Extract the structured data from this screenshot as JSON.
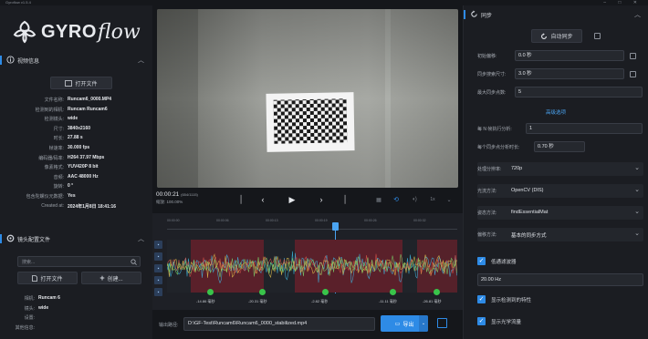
{
  "window": {
    "title": "Gyroflow v1.5.4"
  },
  "logo": {
    "word": "GYRO",
    "script": "flow"
  },
  "video_info": {
    "section_title": "视频信息",
    "open_file_label": "打开文件",
    "rows": [
      {
        "k": "文件名称:",
        "v": "Runcam6_0000.MP4"
      },
      {
        "k": "检测到的相机:",
        "v": "Runcam Runcam6"
      },
      {
        "k": "检测镜头:",
        "v": "wide"
      },
      {
        "k": "尺寸:",
        "v": "3840x2160"
      },
      {
        "k": "时长:",
        "v": "27.88 s"
      },
      {
        "k": "帧速率:",
        "v": "30.000 fps"
      },
      {
        "k": "编码器/码率:",
        "v": "H264 37.97 Mbps"
      },
      {
        "k": "像素格式:",
        "v": "YUV420P 8 bit"
      },
      {
        "k": "音频:",
        "v": "AAC 48000 Hz"
      },
      {
        "k": "旋转:",
        "v": "0 °"
      },
      {
        "k": "包含陀螺仪元数据:",
        "v": "Yes"
      },
      {
        "k": "Created at:",
        "v": "2024年1月8日 18:41:16"
      }
    ]
  },
  "lens_profile": {
    "section_title": "镜头配置文件",
    "search_placeholder": "搜索...",
    "open_file_label": "打开文件",
    "create_label": "创建...",
    "rows": [
      {
        "k": "相机:",
        "v": "Runcam 6"
      },
      {
        "k": "镜头:",
        "v": "wide"
      },
      {
        "k": "设置:",
        "v": ""
      },
      {
        "k": "其他信息:",
        "v": ""
      }
    ]
  },
  "transport": {
    "time": "00:00:21",
    "frame": "(654/1115)",
    "zoom": "缩放: 100.00%",
    "speed": "1x"
  },
  "timeline": {
    "ruler": [
      "00:00:00",
      "00:00:06",
      "00:00:13",
      "00:00:19",
      "00:00:26",
      "00:00:32"
    ],
    "keyframes": [
      "-14.86 毫秒",
      "-20.31 毫秒",
      "-2.82 毫秒",
      "-11.11 毫秒",
      "-26.81 毫秒"
    ]
  },
  "output": {
    "label": "输出路径:",
    "path": "D:\\GF-Test\\Runcam6\\Runcam6_0000_stabilized.mp4",
    "render_label": "导出"
  },
  "sync": {
    "section_title": "同步",
    "autosync_label": "自动同步",
    "rows": [
      {
        "k": "初始偏移:",
        "v": "0.0 秒"
      },
      {
        "k": "同步搜索尺寸:",
        "v": "3.0 秒"
      },
      {
        "k": "最大同步点数:",
        "v": "5"
      }
    ],
    "advanced_link": "高级选项",
    "every_nth_label": "每 N 帧执行分析:",
    "every_nth": "1",
    "duration_label": "每个同步点分析时长:",
    "duration": "0.70 秒",
    "selects": [
      {
        "k": "处理分辨率:",
        "v": "720p"
      },
      {
        "k": "光流方法:",
        "v": "OpenCV (DIS)"
      },
      {
        "k": "姿态方法:",
        "v": "findEssentialMat"
      },
      {
        "k": "偏移方法:",
        "v": "基本的同步方式"
      }
    ],
    "lowpass_label": "低通滤波器",
    "lowpass_value": "20.00 Hz",
    "show_features_label": "显示检测到的特性",
    "show_optflow_label": "显示光学流量"
  },
  "colors": {
    "accent": "#2e8be6",
    "keyframe": "#39c44a"
  }
}
